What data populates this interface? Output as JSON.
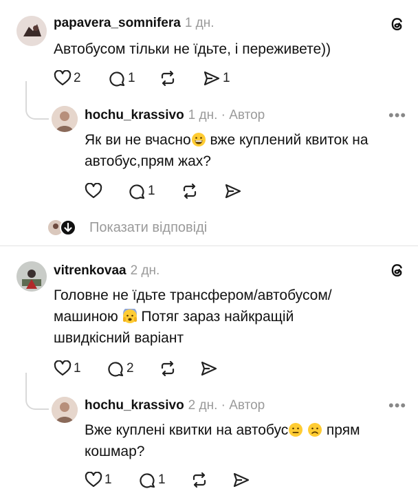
{
  "comments": [
    {
      "username": "papavera_somnifera",
      "time": "1 дн.",
      "text": "Автобусом тільки не їдьте, і переживете))",
      "likes": "2",
      "replies": "1",
      "shares": "1"
    },
    {
      "username": "hochu_krassivo",
      "time": "1 дн. · Автор",
      "text_before_emoji": "Як ви не вчасно",
      "text_after_emoji": " вже куплений квиток на автобус,прям жах?",
      "replies": "1",
      "more": "•••"
    },
    {
      "username": "vitrenkovaa",
      "time": "2 дн.",
      "text_line1": "Головне не їдьте трансфером/автобусом/",
      "text_line2_before": "машиною ",
      "text_line2_after": " Потяг зараз найкращій",
      "text_line3": "швидкісний варіант",
      "likes": "1",
      "replies": "2"
    },
    {
      "username": "hochu_krassivo",
      "time": "2 дн. · Автор",
      "text_before_emoji": "Вже куплені квитки на автобус",
      "text_after_emoji": " прям кошмар?",
      "likes": "1",
      "replies": "1",
      "more": "•••"
    }
  ],
  "show_replies_label": "Показати відповіді",
  "colors": {
    "text": "#111111",
    "meta": "#9a9a9a",
    "thread": "#d9d9d9"
  },
  "icons": [
    "threads-logo-icon",
    "heart-icon",
    "comment-icon",
    "repost-icon",
    "share-icon",
    "arrow-down-icon"
  ]
}
